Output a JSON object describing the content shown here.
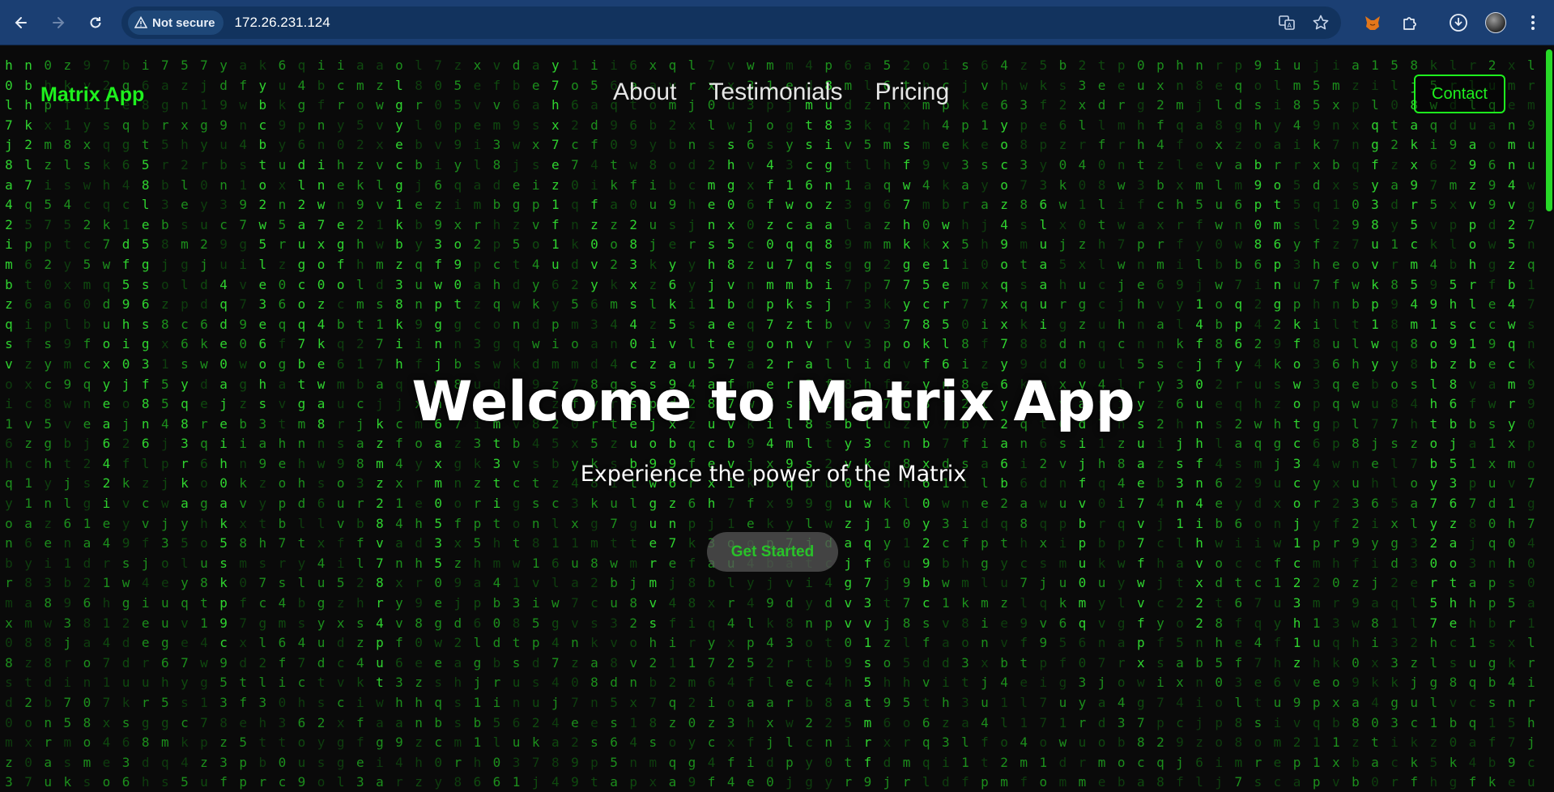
{
  "browser": {
    "security_label": "Not secure",
    "url": "172.26.231.124",
    "icons": [
      "back-icon",
      "forward-icon",
      "reload-icon",
      "warning-icon",
      "translate-icon",
      "star-icon",
      "fox-extension-icon",
      "puzzle-icon",
      "download-icon",
      "profile-avatar",
      "kebab-menu-icon"
    ]
  },
  "site": {
    "brand": "Matrix App",
    "nav": [
      {
        "label": "About"
      },
      {
        "label": "Testimonials"
      },
      {
        "label": "Pricing"
      }
    ],
    "contact_label": "Contact",
    "hero": {
      "title": "Welcome to Matrix App",
      "subtitle": "Experience the power of the Matrix",
      "cta_label": "Get Started"
    }
  },
  "colors": {
    "accent": "#1ef01e",
    "background": "#0a0a0a",
    "browser_chrome": "#1b3f73",
    "text": "#ffffff"
  }
}
